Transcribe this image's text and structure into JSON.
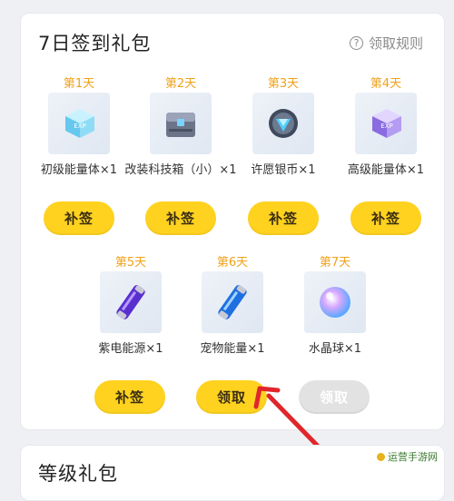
{
  "section": {
    "title": "7日签到礼包",
    "rules_label": "领取规则",
    "rules_icon": "question-circle-icon"
  },
  "days": [
    {
      "day": "第1天",
      "item": "初级能量体×1",
      "icon": "crystal-cube-icon",
      "action": "补签",
      "state": "available"
    },
    {
      "day": "第2天",
      "item": "改装科技箱（小）×1",
      "icon": "tech-chest-icon",
      "action": "补签",
      "state": "available"
    },
    {
      "day": "第3天",
      "item": "许愿银币×1",
      "icon": "silver-coin-icon",
      "action": "补签",
      "state": "available"
    },
    {
      "day": "第4天",
      "item": "高级能量体×1",
      "icon": "purple-crystal-icon",
      "action": "补签",
      "state": "available"
    },
    {
      "day": "第5天",
      "item": "紫电能源×1",
      "icon": "purple-battery-icon",
      "action": "补签",
      "state": "available"
    },
    {
      "day": "第6天",
      "item": "宠物能量×1",
      "icon": "blue-battery-icon",
      "action": "领取",
      "state": "available"
    },
    {
      "day": "第7天",
      "item": "水晶球×1",
      "icon": "crystal-ball-icon",
      "action": "领取",
      "state": "disabled"
    }
  ],
  "next_section": {
    "title": "等级礼包"
  },
  "watermark": "运营手游网",
  "colors": {
    "accent": "#ffd21f",
    "day_label": "#f0a11a",
    "disabled": "#e2e2e2",
    "arrow": "#e0262b"
  }
}
